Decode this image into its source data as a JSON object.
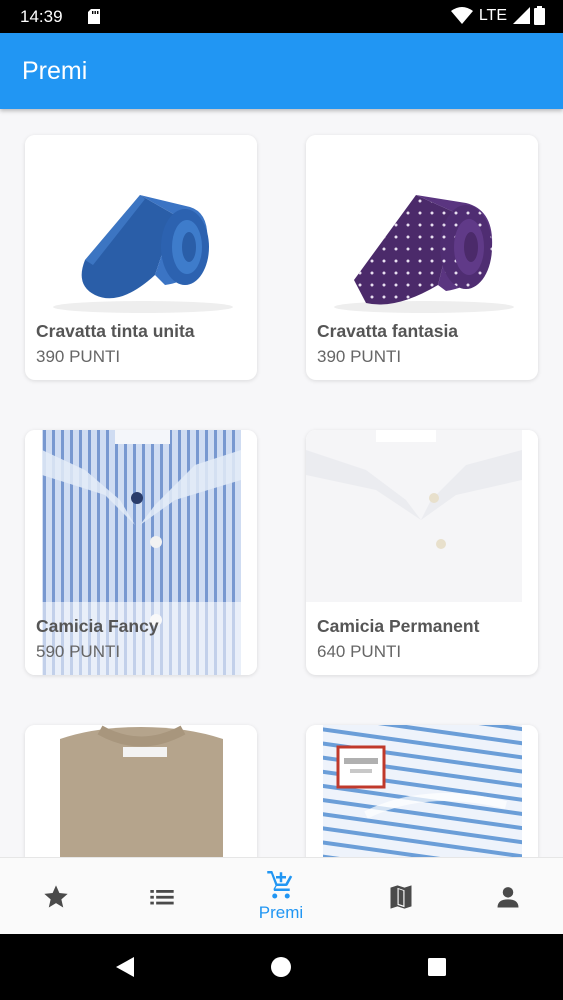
{
  "status_bar": {
    "time": "14:39",
    "network": "LTE"
  },
  "app_bar": {
    "title": "Premi"
  },
  "products": [
    {
      "title": "Cravatta tinta unita",
      "points": "390 PUNTI",
      "image": "blue-tie-image"
    },
    {
      "title": "Cravatta fantasia",
      "points": "390 PUNTI",
      "image": "purple-polka-dot-tie-image"
    },
    {
      "title": "Camicia Fancy",
      "points": "590 PUNTI",
      "image": "blue-striped-shirt-image"
    },
    {
      "title": "Camicia Permanent",
      "points": "640 PUNTI",
      "image": "white-shirt-image"
    },
    {
      "title": "",
      "points": "",
      "image": "beige-sweater-image"
    },
    {
      "title": "",
      "points": "",
      "image": "blue-white-striped-shirt-image"
    }
  ],
  "bottom_nav": {
    "items": [
      {
        "icon": "star-icon",
        "label": ""
      },
      {
        "icon": "list-icon",
        "label": ""
      },
      {
        "icon": "cart-plus-icon",
        "label": "Premi",
        "active": true
      },
      {
        "icon": "map-icon",
        "label": ""
      },
      {
        "icon": "person-icon",
        "label": ""
      }
    ]
  },
  "system_nav": {
    "buttons": [
      "back-icon",
      "home-icon",
      "recents-icon"
    ]
  },
  "colors": {
    "primary": "#2196f3",
    "inactive_icon": "#4a4a4a",
    "status_bar": "#000000"
  }
}
